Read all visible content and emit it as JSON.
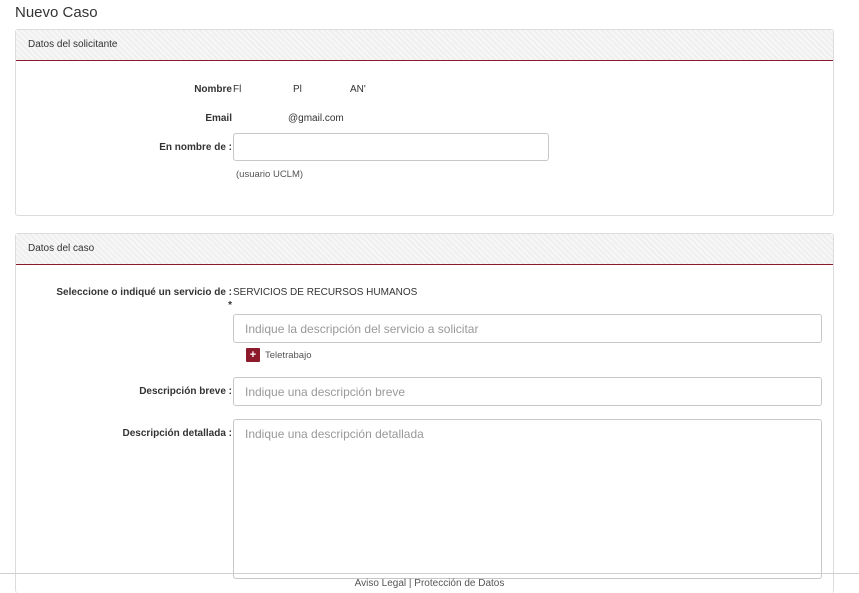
{
  "page": {
    "title": "Nuevo Caso"
  },
  "requester": {
    "header": "Datos del solicitante",
    "name_label": "Nombre",
    "name_parts": [
      "Fl",
      "Pl",
      "AN'"
    ],
    "email_label": "Email",
    "email_value": "@gmail.com",
    "on_behalf_label": "En nombre de :",
    "on_behalf_value": "",
    "on_behalf_hint": "(usuario UCLM)"
  },
  "case": {
    "header": "Datos del caso",
    "service_label": "Seleccione o indiqué un servicio de :",
    "required_mark": "*",
    "service_value": "SERVICIOS DE RECURSOS HUMANOS",
    "service_desc_placeholder": "Indique la descripción del servicio a solicitar",
    "tag_icon": "plus-icon",
    "tag_label": "Teletrabajo",
    "short_desc_label": "Descripción breve :",
    "short_desc_placeholder": "Indique una descripción breve",
    "long_desc_label": "Descripción detallada :",
    "long_desc_placeholder": "Indique una descripción detallada"
  },
  "footer": {
    "text": "Aviso Legal | Protección de Datos"
  },
  "colors": {
    "accent": "#8c1a2b"
  }
}
